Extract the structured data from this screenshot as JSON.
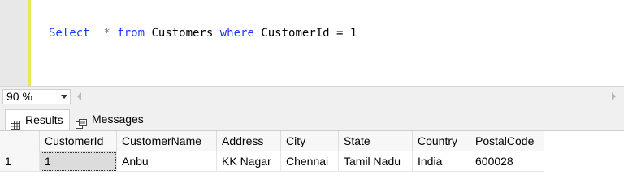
{
  "editor": {
    "kw_select": "Select",
    "star": "  * ",
    "kw_from": "from",
    "table_name": " Customers ",
    "kw_where": "where",
    "condition": " CustomerId = 1"
  },
  "zoom": {
    "value": "90 %"
  },
  "tabs": [
    {
      "label": "Results",
      "icon": "grid-icon"
    },
    {
      "label": "Messages",
      "icon": "messages-icon"
    }
  ],
  "results": {
    "columns": [
      "CustomerId",
      "CustomerName",
      "Address",
      "City",
      "State",
      "Country",
      "PostalCode"
    ],
    "rows": [
      {
        "num": "1",
        "cells": [
          "1",
          "Anbu",
          "KK Nagar",
          "Chennai",
          "Tamil Nadu",
          "India",
          "600028"
        ]
      }
    ]
  }
}
